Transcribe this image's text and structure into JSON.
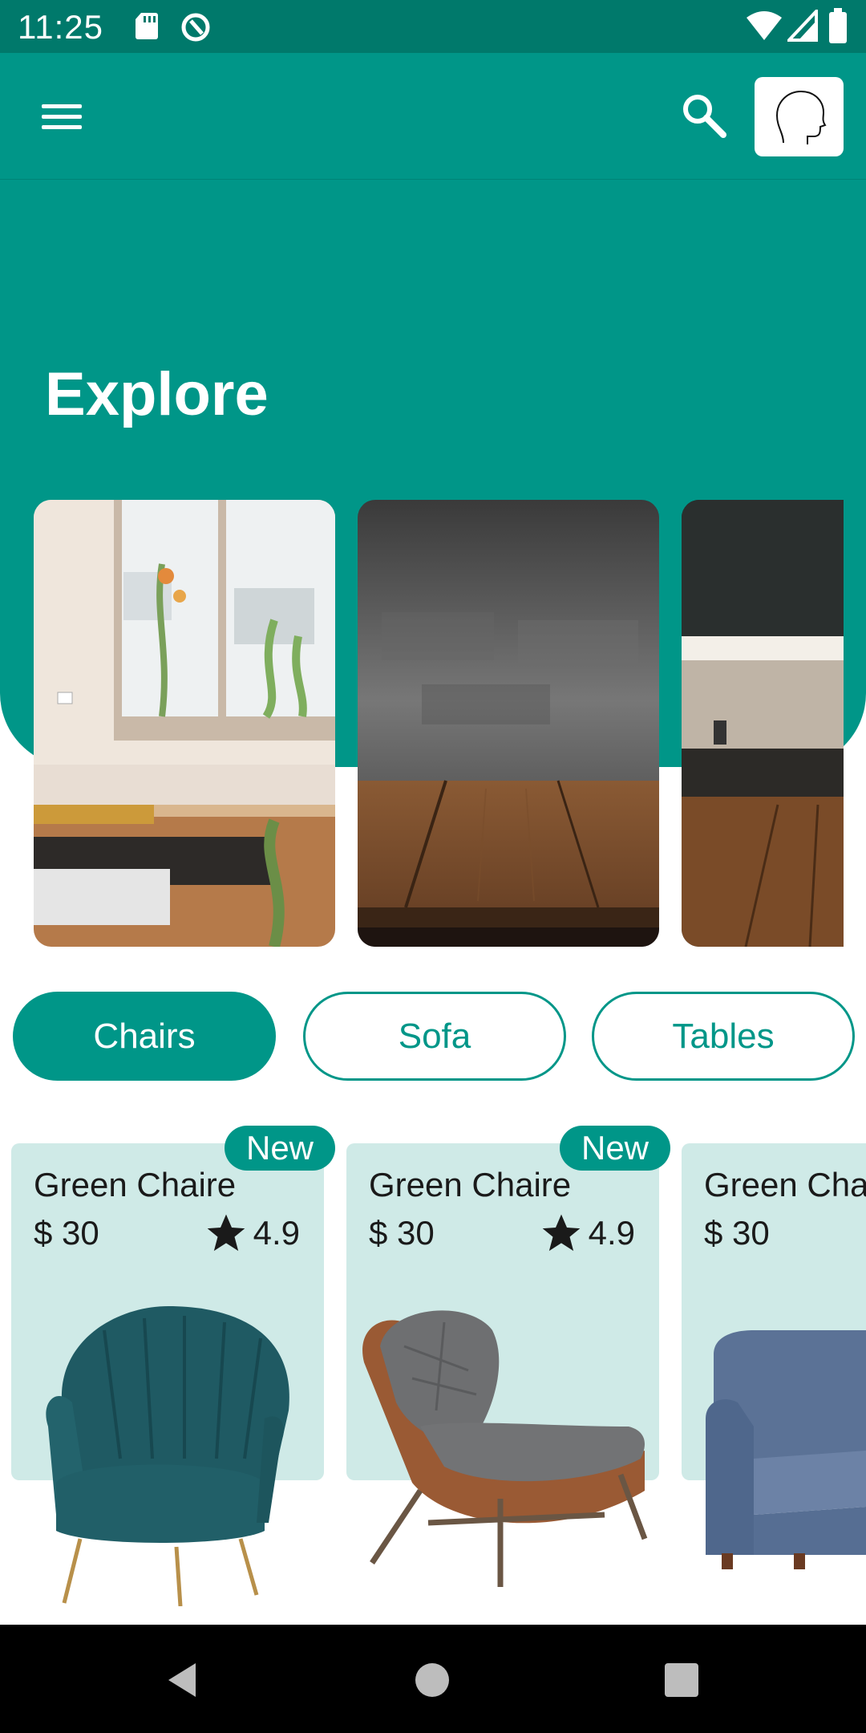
{
  "status_bar": {
    "time": "11:25"
  },
  "header": {
    "title": "Explore"
  },
  "categories": [
    {
      "label": "Chairs",
      "selected": true
    },
    {
      "label": "Sofa",
      "selected": false
    },
    {
      "label": "Tables",
      "selected": false
    }
  ],
  "products": [
    {
      "name": "Green Chaire",
      "price": "$ 30",
      "rating": "4.9",
      "badge": "New"
    },
    {
      "name": "Green Chaire",
      "price": "$ 30",
      "rating": "4.9",
      "badge": "New"
    },
    {
      "name": "Green Chaire",
      "price": "$ 30"
    }
  ],
  "colors": {
    "primary": "#009688",
    "primary_dark": "#00796b",
    "card_bg": "#cfeae7"
  }
}
